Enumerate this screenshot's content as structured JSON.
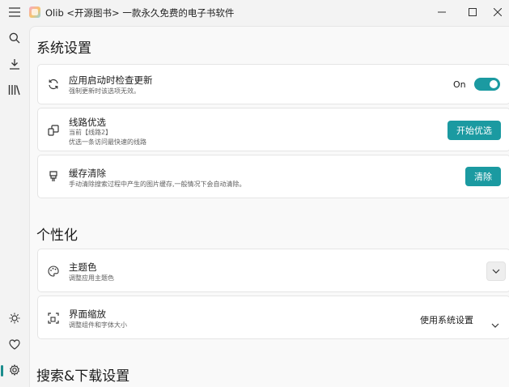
{
  "window": {
    "title": "Olib <开源图书> 一款永久免费的电子书软件",
    "controls": [
      "minimize",
      "maximize",
      "close"
    ]
  },
  "sidebar": {
    "top_items": [
      {
        "name": "search",
        "icon": "search-icon"
      },
      {
        "name": "download",
        "icon": "download-icon"
      },
      {
        "name": "library",
        "icon": "library-icon"
      }
    ],
    "bottom_items": [
      {
        "name": "theme",
        "icon": "sun-icon"
      },
      {
        "name": "favorite",
        "icon": "heart-icon"
      },
      {
        "name": "settings",
        "icon": "gear-icon",
        "active": true
      }
    ]
  },
  "sections": {
    "system": {
      "title": "系统设置",
      "update_check": {
        "title": "应用启动时检查更新",
        "subtitle": "强制更新时该选项无效。",
        "toggle_label": "On",
        "enabled": true
      },
      "route": {
        "title": "线路优选",
        "current": "当前【线路2】",
        "subtitle": "优选一条访问最快速的线路",
        "button_label": "开始优选"
      },
      "cache": {
        "title": "缓存清除",
        "subtitle": "手动清除搜索过程中产生的图片缓存,一般情况下会自动清除。",
        "button_label": "清除"
      }
    },
    "personalize": {
      "title": "个性化",
      "theme_color": {
        "title": "主题色",
        "subtitle": "调整应用主题色"
      },
      "scale": {
        "title": "界面缩放",
        "subtitle": "调整组件和字体大小",
        "value": "使用系统设置"
      }
    },
    "search_download": {
      "title": "搜索&下载设置"
    }
  },
  "colors": {
    "accent": "#1b9aa1",
    "background": "#f3f3f3",
    "content_bg": "#f9f9f9",
    "card_bg": "#ffffff"
  }
}
